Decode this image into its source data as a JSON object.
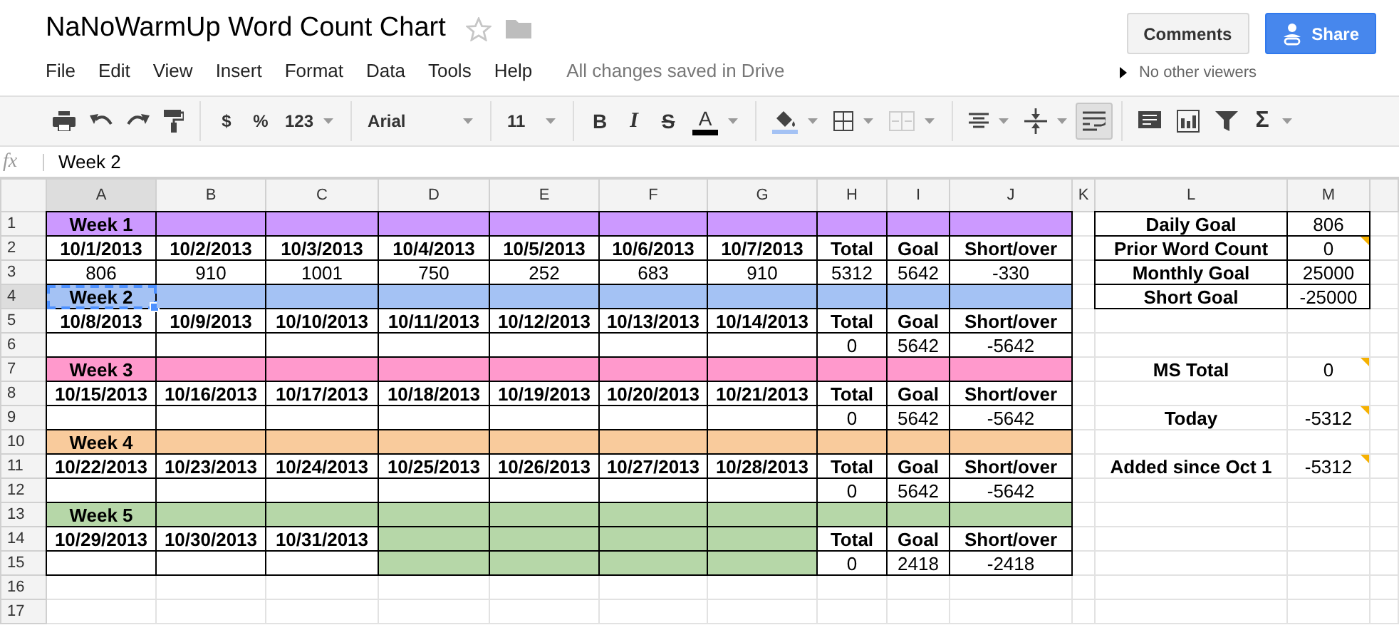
{
  "document": {
    "title": "NaNoWarmUp Word Count Chart",
    "save_status": "All changes saved in Drive",
    "viewers": "No other viewers"
  },
  "menu": [
    "File",
    "Edit",
    "View",
    "Insert",
    "Format",
    "Data",
    "Tools",
    "Help"
  ],
  "buttons": {
    "comments": "Comments",
    "share": "Share"
  },
  "toolbar": [
    {
      "kind": "print"
    },
    {
      "kind": "undo"
    },
    {
      "kind": "redo"
    },
    {
      "kind": "paint_format"
    },
    {
      "kind": "separator"
    },
    {
      "kind": "currency",
      "label": "$"
    },
    {
      "kind": "percent",
      "label": "%"
    },
    {
      "kind": "number_format",
      "label": "123",
      "dropdown": true
    },
    {
      "kind": "separator"
    },
    {
      "kind": "font",
      "label": "Arial",
      "dropdown": true
    },
    {
      "kind": "separator"
    },
    {
      "kind": "size",
      "label": "11",
      "dropdown": true
    },
    {
      "kind": "separator"
    },
    {
      "kind": "bold",
      "label": "B",
      "pressed": false
    },
    {
      "kind": "italic",
      "label": "I",
      "pressed": false
    },
    {
      "kind": "strike",
      "label": "S",
      "pressed": false
    },
    {
      "kind": "text_color",
      "label": "A",
      "color": "#000000",
      "dropdown": true
    },
    {
      "kind": "separator"
    },
    {
      "kind": "fill_color",
      "color": "#a4c2f4",
      "dropdown": true
    },
    {
      "kind": "borders",
      "dropdown": true
    },
    {
      "kind": "merge",
      "disabled": true,
      "dropdown": true
    },
    {
      "kind": "separator"
    },
    {
      "kind": "align",
      "dropdown": true
    },
    {
      "kind": "valign",
      "dropdown": true
    },
    {
      "kind": "wrap",
      "pressed": true
    },
    {
      "kind": "separator"
    },
    {
      "kind": "comment"
    },
    {
      "kind": "chart"
    },
    {
      "kind": "filter"
    },
    {
      "kind": "sum",
      "label": "Σ",
      "dropdown": true
    }
  ],
  "formula_bar": {
    "label": "fx",
    "value": "Week 2"
  },
  "columns": [
    {
      "label": "A",
      "selected": true
    },
    {
      "label": "B",
      "selected": false
    },
    {
      "label": "C",
      "selected": false
    },
    {
      "label": "D",
      "selected": false
    },
    {
      "label": "E",
      "selected": false
    },
    {
      "label": "F",
      "selected": false
    },
    {
      "label": "G",
      "selected": false
    },
    {
      "label": "H",
      "selected": false
    },
    {
      "label": "I",
      "selected": false
    },
    {
      "label": "J",
      "selected": false
    },
    {
      "label": "K",
      "selected": false
    },
    {
      "label": "L",
      "selected": false
    },
    {
      "label": "M",
      "selected": false
    }
  ],
  "rows": [
    {
      "label": "1",
      "selected": false,
      "cells": [
        {
          "text": "Week 1",
          "bold": true,
          "color": "#cc99ff",
          "border": true
        },
        {
          "color": "#cc99ff",
          "border": true
        },
        {
          "color": "#cc99ff",
          "border": true
        },
        {
          "color": "#cc99ff",
          "border": true
        },
        {
          "color": "#cc99ff",
          "border": true
        },
        {
          "color": "#cc99ff",
          "border": true
        },
        {
          "color": "#cc99ff",
          "border": true
        },
        {
          "color": "#cc99ff",
          "border": true
        },
        {
          "color": "#cc99ff",
          "border": true
        },
        {
          "color": "#cc99ff",
          "border": true
        },
        {},
        {
          "text": "Daily Goal",
          "bold": true,
          "border": true
        },
        {
          "text": "806",
          "bold": false,
          "border": true
        }
      ]
    },
    {
      "label": "2",
      "selected": false,
      "cells": [
        {
          "text": "10/1/2013",
          "bold": true,
          "border": true
        },
        {
          "text": "10/2/2013",
          "bold": true,
          "border": true
        },
        {
          "text": "10/3/2013",
          "bold": true,
          "border": true
        },
        {
          "text": "10/4/2013",
          "bold": true,
          "border": true
        },
        {
          "text": "10/5/2013",
          "bold": true,
          "border": true
        },
        {
          "text": "10/6/2013",
          "bold": true,
          "border": true
        },
        {
          "text": "10/7/2013",
          "bold": true,
          "border": true
        },
        {
          "text": "Total",
          "bold": true,
          "border": true
        },
        {
          "text": "Goal",
          "bold": true,
          "border": true
        },
        {
          "text": "Short/over",
          "bold": true,
          "border": true
        },
        {},
        {
          "text": "Prior Word Count",
          "bold": true,
          "border": true
        },
        {
          "text": "0",
          "bold": false,
          "border": true,
          "note": true
        }
      ]
    },
    {
      "label": "3",
      "selected": false,
      "cells": [
        {
          "text": "806",
          "bold": false,
          "border": true
        },
        {
          "text": "910",
          "bold": false,
          "border": true
        },
        {
          "text": "1001",
          "bold": false,
          "border": true
        },
        {
          "text": "750",
          "bold": false,
          "border": true
        },
        {
          "text": "252",
          "bold": false,
          "border": true
        },
        {
          "text": "683",
          "bold": false,
          "border": true
        },
        {
          "text": "910",
          "bold": false,
          "border": true
        },
        {
          "text": "5312",
          "bold": false,
          "border": true
        },
        {
          "text": "5642",
          "bold": false,
          "border": true
        },
        {
          "text": "-330",
          "bold": false,
          "border": true
        },
        {},
        {
          "text": "Monthly Goal",
          "bold": true,
          "border": true
        },
        {
          "text": "25000",
          "bold": false,
          "border": true
        }
      ]
    },
    {
      "label": "4",
      "selected": true,
      "cells": [
        {
          "text": "Week 2",
          "bold": true,
          "color": "#a4c2f4",
          "border": true
        },
        {
          "color": "#a4c2f4",
          "border": true
        },
        {
          "color": "#a4c2f4",
          "border": true
        },
        {
          "color": "#a4c2f4",
          "border": true
        },
        {
          "color": "#a4c2f4",
          "border": true
        },
        {
          "color": "#a4c2f4",
          "border": true
        },
        {
          "color": "#a4c2f4",
          "border": true
        },
        {
          "color": "#a4c2f4",
          "border": true
        },
        {
          "color": "#a4c2f4",
          "border": true
        },
        {
          "color": "#a4c2f4",
          "border": true
        },
        {},
        {
          "text": "Short Goal",
          "bold": true,
          "border": true
        },
        {
          "text": "-25000",
          "bold": false,
          "border": true
        }
      ]
    },
    {
      "label": "5",
      "selected": false,
      "cells": [
        {
          "text": "10/8/2013",
          "bold": true,
          "border": true
        },
        {
          "text": "10/9/2013",
          "bold": true,
          "border": true
        },
        {
          "text": "10/10/2013",
          "bold": true,
          "border": true
        },
        {
          "text": "10/11/2013",
          "bold": true,
          "border": true
        },
        {
          "text": "10/12/2013",
          "bold": true,
          "border": true
        },
        {
          "text": "10/13/2013",
          "bold": true,
          "border": true
        },
        {
          "text": "10/14/2013",
          "bold": true,
          "border": true
        },
        {
          "text": "Total",
          "bold": true,
          "border": true
        },
        {
          "text": "Goal",
          "bold": true,
          "border": true
        },
        {
          "text": "Short/over",
          "bold": true,
          "border": true
        },
        {},
        {},
        {}
      ]
    },
    {
      "label": "6",
      "selected": false,
      "cells": [
        {
          "border": true
        },
        {
          "border": true
        },
        {
          "border": true
        },
        {
          "border": true
        },
        {
          "border": true
        },
        {
          "border": true
        },
        {
          "border": true
        },
        {
          "text": "0",
          "bold": false,
          "border": true
        },
        {
          "text": "5642",
          "bold": false,
          "border": true
        },
        {
          "text": "-5642",
          "bold": false,
          "border": true
        },
        {},
        {},
        {}
      ]
    },
    {
      "label": "7",
      "selected": false,
      "cells": [
        {
          "text": "Week 3",
          "bold": true,
          "color": "#ff99cc",
          "border": true
        },
        {
          "color": "#ff99cc",
          "border": true
        },
        {
          "color": "#ff99cc",
          "border": true
        },
        {
          "color": "#ff99cc",
          "border": true
        },
        {
          "color": "#ff99cc",
          "border": true
        },
        {
          "color": "#ff99cc",
          "border": true
        },
        {
          "color": "#ff99cc",
          "border": true
        },
        {
          "color": "#ff99cc",
          "border": true
        },
        {
          "color": "#ff99cc",
          "border": true
        },
        {
          "color": "#ff99cc",
          "border": true
        },
        {},
        {
          "text": "MS Total",
          "bold": true
        },
        {
          "text": "0",
          "bold": false,
          "note": true
        }
      ]
    },
    {
      "label": "8",
      "selected": false,
      "cells": [
        {
          "text": "10/15/2013",
          "bold": true,
          "border": true
        },
        {
          "text": "10/16/2013",
          "bold": true,
          "border": true
        },
        {
          "text": "10/17/2013",
          "bold": true,
          "border": true
        },
        {
          "text": "10/18/2013",
          "bold": true,
          "border": true
        },
        {
          "text": "10/19/2013",
          "bold": true,
          "border": true
        },
        {
          "text": "10/20/2013",
          "bold": true,
          "border": true
        },
        {
          "text": "10/21/2013",
          "bold": true,
          "border": true
        },
        {
          "text": "Total",
          "bold": true,
          "border": true
        },
        {
          "text": "Goal",
          "bold": true,
          "border": true
        },
        {
          "text": "Short/over",
          "bold": true,
          "border": true
        },
        {},
        {},
        {}
      ]
    },
    {
      "label": "9",
      "selected": false,
      "cells": [
        {
          "border": true
        },
        {
          "border": true
        },
        {
          "border": true
        },
        {
          "border": true
        },
        {
          "border": true
        },
        {
          "border": true
        },
        {
          "border": true
        },
        {
          "text": "0",
          "bold": false,
          "border": true
        },
        {
          "text": "5642",
          "bold": false,
          "border": true
        },
        {
          "text": "-5642",
          "bold": false,
          "border": true
        },
        {},
        {
          "text": "Today",
          "bold": true
        },
        {
          "text": "-5312",
          "bold": false,
          "note": true
        }
      ]
    },
    {
      "label": "10",
      "selected": false,
      "cells": [
        {
          "text": "Week 4",
          "bold": true,
          "color": "#f9cb9c",
          "border": true
        },
        {
          "color": "#f9cb9c",
          "border": true
        },
        {
          "color": "#f9cb9c",
          "border": true
        },
        {
          "color": "#f9cb9c",
          "border": true
        },
        {
          "color": "#f9cb9c",
          "border": true
        },
        {
          "color": "#f9cb9c",
          "border": true
        },
        {
          "color": "#f9cb9c",
          "border": true
        },
        {
          "color": "#f9cb9c",
          "border": true
        },
        {
          "color": "#f9cb9c",
          "border": true
        },
        {
          "color": "#f9cb9c",
          "border": true
        },
        {},
        {},
        {}
      ]
    },
    {
      "label": "11",
      "selected": false,
      "cells": [
        {
          "text": "10/22/2013",
          "bold": true,
          "border": true
        },
        {
          "text": "10/23/2013",
          "bold": true,
          "border": true
        },
        {
          "text": "10/24/2013",
          "bold": true,
          "border": true
        },
        {
          "text": "10/25/2013",
          "bold": true,
          "border": true
        },
        {
          "text": "10/26/2013",
          "bold": true,
          "border": true
        },
        {
          "text": "10/27/2013",
          "bold": true,
          "border": true
        },
        {
          "text": "10/28/2013",
          "bold": true,
          "border": true
        },
        {
          "text": "Total",
          "bold": true,
          "border": true
        },
        {
          "text": "Goal",
          "bold": true,
          "border": true
        },
        {
          "text": "Short/over",
          "bold": true,
          "border": true
        },
        {},
        {
          "text": "Added since Oct 1",
          "bold": true
        },
        {
          "text": "-5312",
          "bold": false,
          "note": true
        }
      ]
    },
    {
      "label": "12",
      "selected": false,
      "cells": [
        {
          "border": true
        },
        {
          "border": true
        },
        {
          "border": true
        },
        {
          "border": true
        },
        {
          "border": true
        },
        {
          "border": true
        },
        {
          "border": true
        },
        {
          "text": "0",
          "bold": false,
          "border": true
        },
        {
          "text": "5642",
          "bold": false,
          "border": true
        },
        {
          "text": "-5642",
          "bold": false,
          "border": true
        },
        {},
        {},
        {}
      ]
    },
    {
      "label": "13",
      "selected": false,
      "cells": [
        {
          "text": "Week 5",
          "bold": true,
          "color": "#b6d7a8",
          "border": true
        },
        {
          "color": "#b6d7a8",
          "border": true
        },
        {
          "color": "#b6d7a8",
          "border": true
        },
        {
          "color": "#b6d7a8",
          "border": true
        },
        {
          "color": "#b6d7a8",
          "border": true
        },
        {
          "color": "#b6d7a8",
          "border": true
        },
        {
          "color": "#b6d7a8",
          "border": true
        },
        {
          "color": "#b6d7a8",
          "border": true
        },
        {
          "color": "#b6d7a8",
          "border": true
        },
        {
          "color": "#b6d7a8",
          "border": true
        },
        {},
        {},
        {}
      ]
    },
    {
      "label": "14",
      "selected": false,
      "cells": [
        {
          "text": "10/29/2013",
          "bold": true,
          "border": true
        },
        {
          "text": "10/30/2013",
          "bold": true,
          "border": true
        },
        {
          "text": "10/31/2013",
          "bold": true,
          "border": true
        },
        {
          "color": "#b6d7a8",
          "border": true
        },
        {
          "color": "#b6d7a8",
          "border": true
        },
        {
          "color": "#b6d7a8",
          "border": true
        },
        {
          "color": "#b6d7a8",
          "border": true
        },
        {
          "text": "Total",
          "bold": true,
          "border": true
        },
        {
          "text": "Goal",
          "bold": true,
          "border": true
        },
        {
          "text": "Short/over",
          "bold": true,
          "border": true
        },
        {},
        {},
        {}
      ]
    },
    {
      "label": "15",
      "selected": false,
      "cells": [
        {
          "border": true
        },
        {
          "border": true
        },
        {
          "border": true
        },
        {
          "color": "#b6d7a8",
          "border": true
        },
        {
          "color": "#b6d7a8",
          "border": true
        },
        {
          "color": "#b6d7a8",
          "border": true
        },
        {
          "color": "#b6d7a8",
          "border": true
        },
        {
          "text": "0",
          "bold": false,
          "border": true
        },
        {
          "text": "2418",
          "bold": false,
          "border": true
        },
        {
          "text": "-2418",
          "bold": false,
          "border": true
        },
        {},
        {},
        {}
      ]
    },
    {
      "label": "16",
      "selected": false
    },
    {
      "label": "17",
      "selected": false
    }
  ]
}
